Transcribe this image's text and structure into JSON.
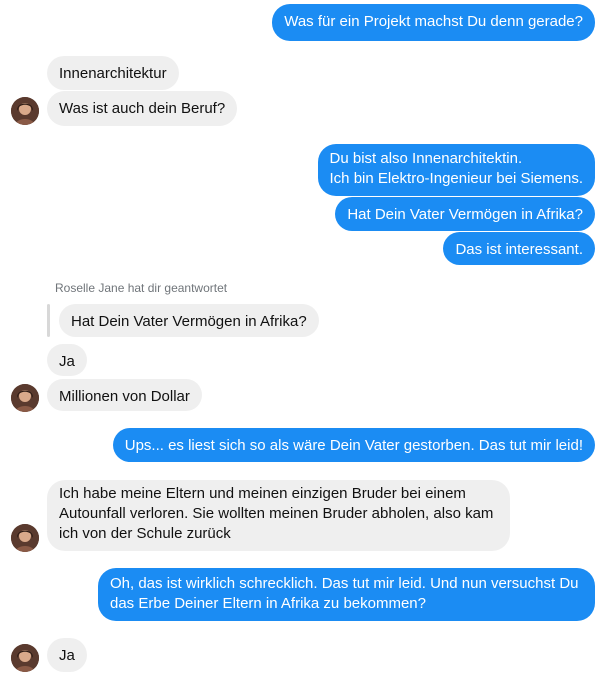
{
  "messages": {
    "m1": "Was für ein Projekt machst Du denn gerade?",
    "m2": "Innenarchitektur",
    "m3": "Was ist auch dein Beruf?",
    "m4_line1": "Du bist also Innenarchitektin.",
    "m4_line2": "Ich bin Elektro-Ingenieur bei Siemens.",
    "m5": "Hat Dein Vater Vermögen in Afrika?",
    "m6": "Das ist interessant.",
    "reply_meta": "Roselle Jane hat dir geantwortet",
    "reply_quote": "Hat Dein Vater Vermögen in Afrika?",
    "m7": "Ja",
    "m8": "Millionen von Dollar",
    "m9": "Ups... es liest sich so als wäre Dein Vater gestorben. Das tut mir leid!",
    "m10_line1": "Ich habe meine Eltern und meinen einzigen Bruder bei einem",
    "m10_line2": "Autounfall verloren. Sie wollten meinen Bruder abholen, also kam",
    "m10_line3": "ich von der Schule zurück",
    "m11_line1": "Oh, das ist wirklich schrecklich. Das tut mir leid. Und nun versuchst Du",
    "m11_line2": "das Erbe Deiner Eltern in Afrika zu bekommen?",
    "m12": "Ja"
  },
  "colors": {
    "outgoing": "#1b8cf3",
    "incoming": "#efefef"
  },
  "icons": {
    "avatar": "contact-avatar-photo"
  }
}
